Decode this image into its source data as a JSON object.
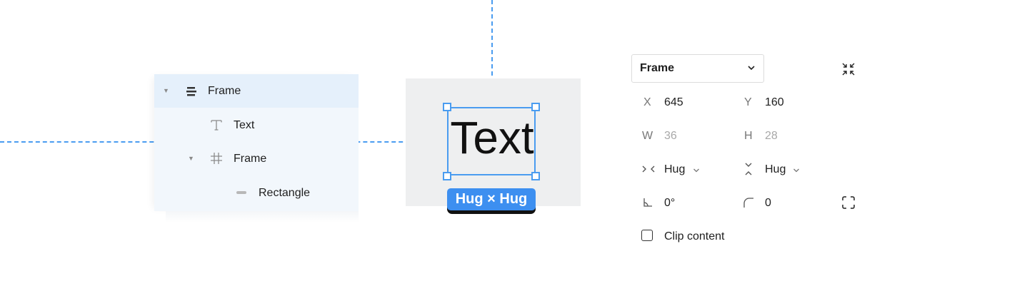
{
  "layers": {
    "items": [
      {
        "label": "Frame",
        "icon": "auto-layout-icon",
        "caret": "▼"
      },
      {
        "label": "Text",
        "icon": "text-icon"
      },
      {
        "label": "Frame",
        "icon": "frame-hash-icon",
        "caret": "▼"
      },
      {
        "label": "Rectangle",
        "icon": "rectangle-icon"
      }
    ]
  },
  "canvas": {
    "text": "Text",
    "size_badge": "Hug × Hug"
  },
  "properties": {
    "frame_select": "Frame",
    "x_label": "X",
    "x_value": "645",
    "y_label": "Y",
    "y_value": "160",
    "w_label": "W",
    "w_value": "36",
    "h_label": "H",
    "h_value": "28",
    "hug_horizontal": "Hug",
    "hug_vertical": "Hug",
    "rotation": "0°",
    "corner_radius": "0",
    "clip_content": "Clip content"
  },
  "colors": {
    "accent": "#4a9cf0",
    "badge": "#3d8ff0",
    "selected_row": "#e5f0fb",
    "panel_bg": "#f2f7fc",
    "canvas_frame": "#eeeff0"
  }
}
